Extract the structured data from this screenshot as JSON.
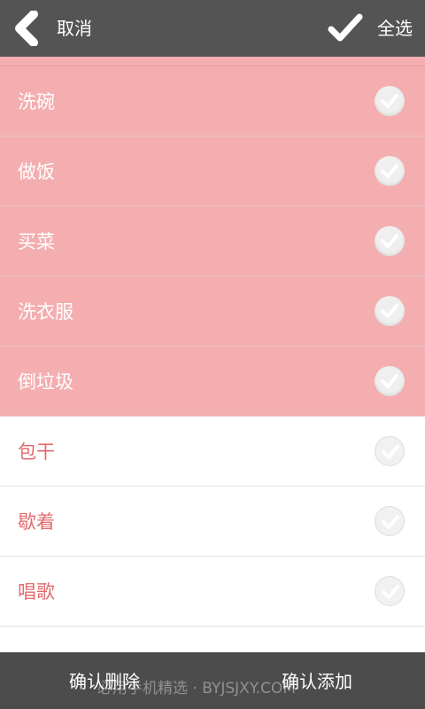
{
  "header": {
    "cancel_label": "取消",
    "select_all_label": "全选",
    "back_icon": "chevron-left-icon",
    "select_all_icon": "checkmark-icon"
  },
  "list": {
    "items": [
      {
        "label": "洗碗",
        "selected": true
      },
      {
        "label": "做饭",
        "selected": true
      },
      {
        "label": "买菜",
        "selected": true
      },
      {
        "label": "洗衣服",
        "selected": true
      },
      {
        "label": "倒垃圾",
        "selected": true
      },
      {
        "label": "包干",
        "selected": false
      },
      {
        "label": "歇着",
        "selected": false
      },
      {
        "label": "唱歌",
        "selected": false
      }
    ]
  },
  "footer": {
    "confirm_delete_label": "确认删除",
    "confirm_add_label": "确认添加"
  },
  "watermark": "必用手机精选 · BYJSJXY.COM",
  "colors": {
    "header_bg": "#545454",
    "selected_row_bg": "#f4aeb0",
    "unselected_text": "#e26a6d",
    "footer_bg": "#4c4c4c"
  }
}
